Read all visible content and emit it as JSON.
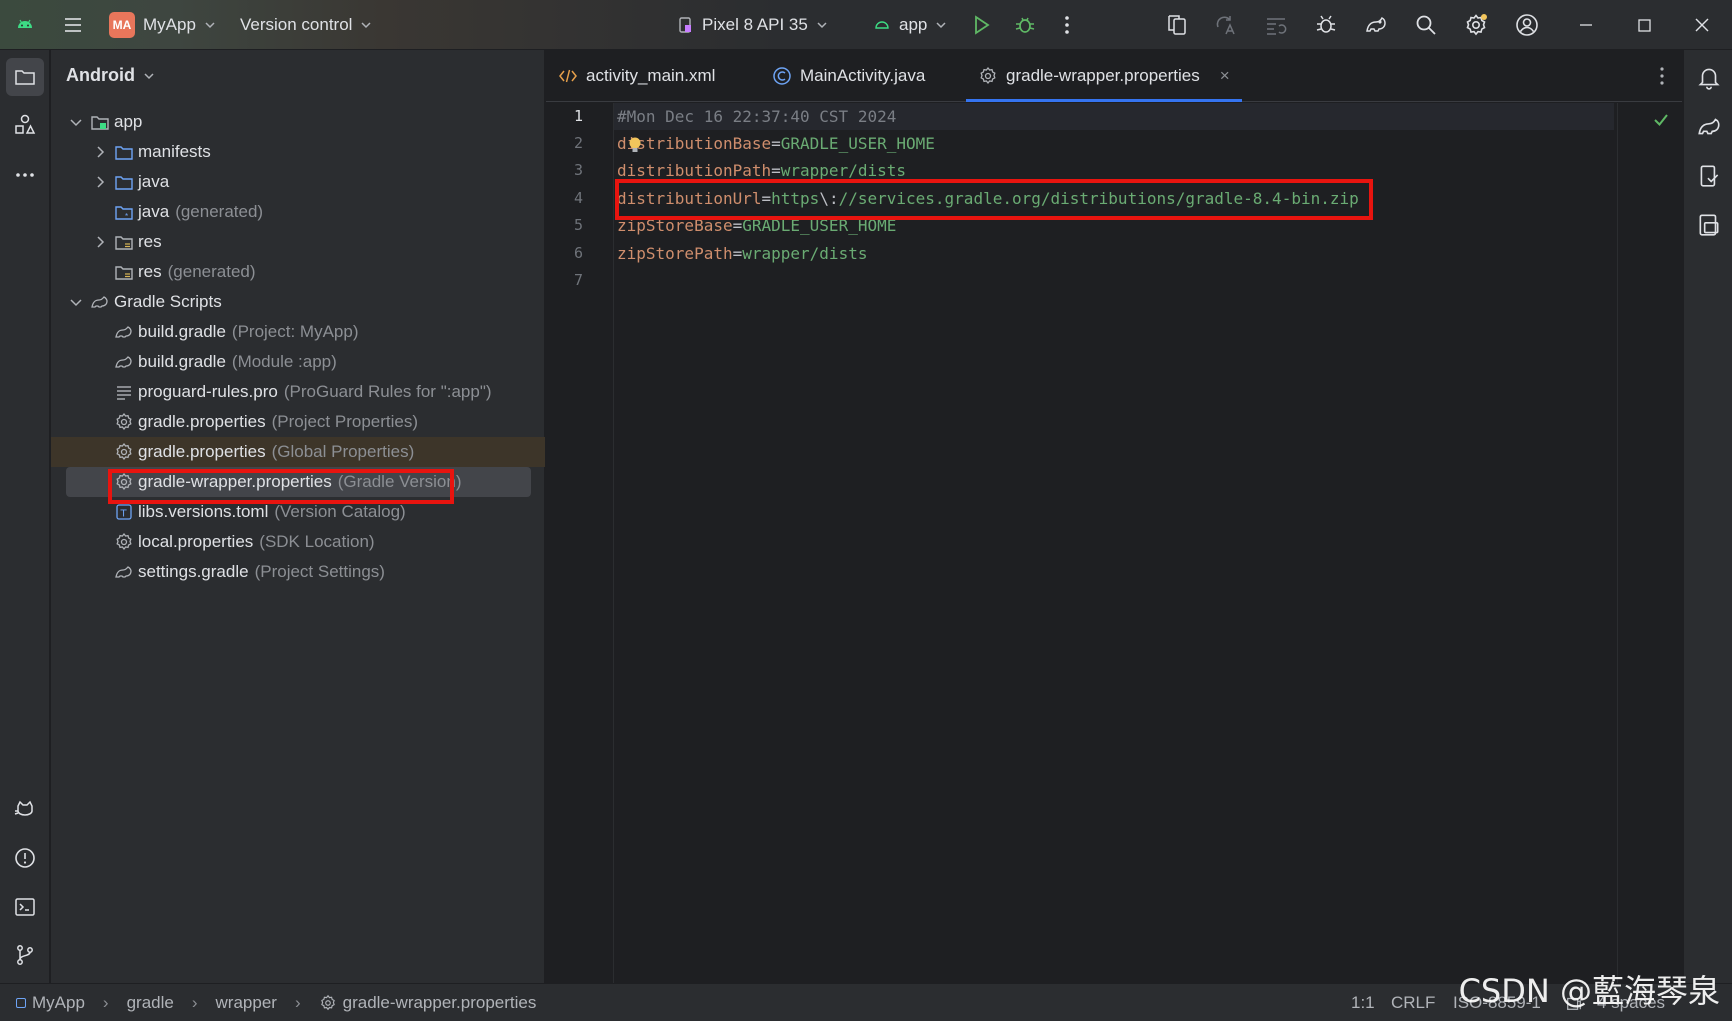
{
  "titlebar": {
    "project_badge": "MA",
    "project_name": "MyApp",
    "vcs_label": "Version control",
    "device_label": "Pixel 8 API 35",
    "run_config": "app"
  },
  "project_panel": {
    "view_label": "Android",
    "tree": [
      {
        "name": "app",
        "hint": ""
      },
      {
        "name": "manifests",
        "hint": ""
      },
      {
        "name": "java",
        "hint": ""
      },
      {
        "name": "java",
        "hint": "(generated)"
      },
      {
        "name": "res",
        "hint": ""
      },
      {
        "name": "res",
        "hint": "(generated)"
      },
      {
        "name": "Gradle Scripts",
        "hint": ""
      },
      {
        "name": "build.gradle",
        "hint": "(Project: MyApp)"
      },
      {
        "name": "build.gradle",
        "hint": "(Module :app)"
      },
      {
        "name": "proguard-rules.pro",
        "hint": "(ProGuard Rules for \":app\")"
      },
      {
        "name": "gradle.properties",
        "hint": "(Project Properties)"
      },
      {
        "name": "gradle.properties",
        "hint": "(Global Properties)"
      },
      {
        "name": "gradle-wrapper.properties",
        "hint": "(Gradle Version)"
      },
      {
        "name": "libs.versions.toml",
        "hint": "(Version Catalog)"
      },
      {
        "name": "local.properties",
        "hint": "(SDK Location)"
      },
      {
        "name": "settings.gradle",
        "hint": "(Project Settings)"
      }
    ]
  },
  "tabs": [
    {
      "label": "activity_main.xml"
    },
    {
      "label": "MainActivity.java"
    },
    {
      "label": "gradle-wrapper.properties",
      "close": "×"
    }
  ],
  "editor": {
    "line_numbers": [
      "1",
      "2",
      "3",
      "4",
      "5",
      "6",
      "7"
    ],
    "lines": [
      {
        "comment": "#Mon Dec 16 22:37:40 CST 2024"
      },
      {
        "key": "distributionBase",
        "eq": "=",
        "value": "GRADLE_USER_HOME"
      },
      {
        "key": "distributionPath",
        "eq": "=",
        "value": "wrapper/dists"
      },
      {
        "key": "distributionUrl",
        "eq": "=",
        "value1": "https",
        "esc": "\\:",
        "value2": "//services.gradle.org/distributions/gradle-8.4-bin.zip"
      },
      {
        "key": "zipStoreBase",
        "eq": "=",
        "value": "GRADLE_USER_HOME"
      },
      {
        "key": "zipStorePath",
        "eq": "=",
        "value": "wrapper/dists"
      }
    ]
  },
  "statusbar": {
    "breadcrumbs": [
      "MyApp",
      "gradle",
      "wrapper",
      "gradle-wrapper.properties"
    ],
    "position": "1:1",
    "line_sep": "CRLF",
    "encoding": "ISO-8859-1",
    "indent": "4 spaces"
  },
  "watermark": "CSDN @藍海琴泉",
  "colors": {
    "accent": "#3574f0",
    "highlight_box": "#e8140f",
    "key": "#cf8e6d",
    "value": "#6aab73",
    "comment": "#7a7e85"
  }
}
